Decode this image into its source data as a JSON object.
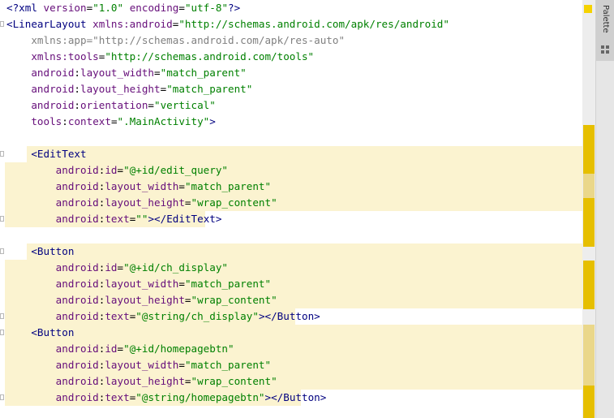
{
  "editor": {
    "lines": [
      {
        "parts": [
          [
            "tag",
            "<?"
          ],
          [
            "pi",
            "xml "
          ],
          [
            "attr",
            "version"
          ],
          [
            "txt",
            "="
          ],
          [
            "val",
            "\"1.0\""
          ],
          [
            "txt",
            " "
          ],
          [
            "attr",
            "encoding"
          ],
          [
            "txt",
            "="
          ],
          [
            "val",
            "\"utf-8\""
          ],
          [
            "tag",
            "?>"
          ]
        ]
      },
      {
        "parts": [
          [
            "tag",
            "<LinearLayout "
          ],
          [
            "attr",
            "xmlns:android"
          ],
          [
            "txt",
            "="
          ],
          [
            "val",
            "\"http://schemas.android.com/apk/res/android\""
          ]
        ]
      },
      {
        "parts": [
          [
            "gray",
            "    xmlns:app"
          ],
          [
            "gray",
            "="
          ],
          [
            "gray",
            "\"http://schemas.android.com/apk/res-auto\""
          ]
        ]
      },
      {
        "parts": [
          [
            "txt",
            "    "
          ],
          [
            "attr",
            "xmlns:tools"
          ],
          [
            "txt",
            "="
          ],
          [
            "val",
            "\"http://schemas.android.com/tools\""
          ]
        ]
      },
      {
        "parts": [
          [
            "txt",
            "    "
          ],
          [
            "attr",
            "android"
          ],
          [
            "txt",
            ":"
          ],
          [
            "attr",
            "layout_width"
          ],
          [
            "txt",
            "="
          ],
          [
            "val",
            "\"match_parent\""
          ]
        ]
      },
      {
        "parts": [
          [
            "txt",
            "    "
          ],
          [
            "attr",
            "android"
          ],
          [
            "txt",
            ":"
          ],
          [
            "attr",
            "layout_height"
          ],
          [
            "txt",
            "="
          ],
          [
            "val",
            "\"match_parent\""
          ]
        ]
      },
      {
        "parts": [
          [
            "txt",
            "    "
          ],
          [
            "attr",
            "android"
          ],
          [
            "txt",
            ":"
          ],
          [
            "attr",
            "orientation"
          ],
          [
            "txt",
            "="
          ],
          [
            "val",
            "\"vertical\""
          ]
        ]
      },
      {
        "parts": [
          [
            "txt",
            "    "
          ],
          [
            "attr",
            "tools"
          ],
          [
            "txt",
            ":"
          ],
          [
            "attr",
            "context"
          ],
          [
            "txt",
            "="
          ],
          [
            "val",
            "\".MainActivity\""
          ],
          [
            "tag",
            ">"
          ]
        ]
      },
      {
        "parts": []
      },
      {
        "parts": [
          [
            "txt",
            "    "
          ],
          [
            "tag",
            "<EditText"
          ]
        ]
      },
      {
        "parts": [
          [
            "txt",
            "        "
          ],
          [
            "attr",
            "android"
          ],
          [
            "txt",
            ":"
          ],
          [
            "attr",
            "id"
          ],
          [
            "txt",
            "="
          ],
          [
            "val",
            "\"@+id/edit_query\""
          ]
        ]
      },
      {
        "parts": [
          [
            "txt",
            "        "
          ],
          [
            "attr",
            "android"
          ],
          [
            "txt",
            ":"
          ],
          [
            "attr",
            "layout_width"
          ],
          [
            "txt",
            "="
          ],
          [
            "val",
            "\"match_parent\""
          ]
        ]
      },
      {
        "parts": [
          [
            "txt",
            "        "
          ],
          [
            "attr",
            "android"
          ],
          [
            "txt",
            ":"
          ],
          [
            "attr",
            "layout_height"
          ],
          [
            "txt",
            "="
          ],
          [
            "val",
            "\"wrap_content\""
          ]
        ]
      },
      {
        "parts": [
          [
            "txt",
            "        "
          ],
          [
            "attr",
            "android"
          ],
          [
            "txt",
            ":"
          ],
          [
            "attr",
            "text"
          ],
          [
            "txt",
            "="
          ],
          [
            "val",
            "\"\""
          ],
          [
            "tag",
            "></EditText>"
          ]
        ]
      },
      {
        "parts": []
      },
      {
        "parts": [
          [
            "txt",
            "    "
          ],
          [
            "tag",
            "<Button"
          ]
        ]
      },
      {
        "parts": [
          [
            "txt",
            "        "
          ],
          [
            "attr",
            "android"
          ],
          [
            "txt",
            ":"
          ],
          [
            "attr",
            "id"
          ],
          [
            "txt",
            "="
          ],
          [
            "val",
            "\"@+id/ch_display\""
          ]
        ]
      },
      {
        "parts": [
          [
            "txt",
            "        "
          ],
          [
            "attr",
            "android"
          ],
          [
            "txt",
            ":"
          ],
          [
            "attr",
            "layout_width"
          ],
          [
            "txt",
            "="
          ],
          [
            "val",
            "\"match_parent\""
          ]
        ]
      },
      {
        "parts": [
          [
            "txt",
            "        "
          ],
          [
            "attr",
            "android"
          ],
          [
            "txt",
            ":"
          ],
          [
            "attr",
            "layout_height"
          ],
          [
            "txt",
            "="
          ],
          [
            "val",
            "\"wrap_content\""
          ]
        ]
      },
      {
        "parts": [
          [
            "txt",
            "        "
          ],
          [
            "attr",
            "android"
          ],
          [
            "txt",
            ":"
          ],
          [
            "attr",
            "text"
          ],
          [
            "txt",
            "="
          ],
          [
            "val",
            "\"@string/ch_display\""
          ],
          [
            "tag",
            "></Button>"
          ]
        ]
      },
      {
        "parts": [
          [
            "txt",
            "    "
          ],
          [
            "tag",
            "<Button"
          ]
        ]
      },
      {
        "parts": [
          [
            "txt",
            "        "
          ],
          [
            "attr",
            "android"
          ],
          [
            "txt",
            ":"
          ],
          [
            "attr",
            "id"
          ],
          [
            "txt",
            "="
          ],
          [
            "val",
            "\"@+id/homepagebtn\""
          ]
        ]
      },
      {
        "parts": [
          [
            "txt",
            "        "
          ],
          [
            "attr",
            "android"
          ],
          [
            "txt",
            ":"
          ],
          [
            "attr",
            "layout_width"
          ],
          [
            "txt",
            "="
          ],
          [
            "val",
            "\"match_parent\""
          ]
        ]
      },
      {
        "parts": [
          [
            "txt",
            "        "
          ],
          [
            "attr",
            "android"
          ],
          [
            "txt",
            ":"
          ],
          [
            "attr",
            "layout_height"
          ],
          [
            "txt",
            "="
          ],
          [
            "val",
            "\"wrap_content\""
          ]
        ]
      },
      {
        "parts": [
          [
            "txt",
            "        "
          ],
          [
            "attr",
            "android"
          ],
          [
            "txt",
            ":"
          ],
          [
            "attr",
            "text"
          ],
          [
            "txt",
            "="
          ],
          [
            "val",
            "\"@string/homepagebtn\""
          ],
          [
            "tag",
            "></Button>"
          ]
        ]
      }
    ]
  },
  "sidebar": {
    "palette_label": "Palette",
    "palette_icon": "palette-icon"
  },
  "colors": {
    "tag": "#000080",
    "attribute": "#660e7a",
    "value": "#008000",
    "highlight": "#fbf3d0",
    "marker": "#e6bf00"
  }
}
